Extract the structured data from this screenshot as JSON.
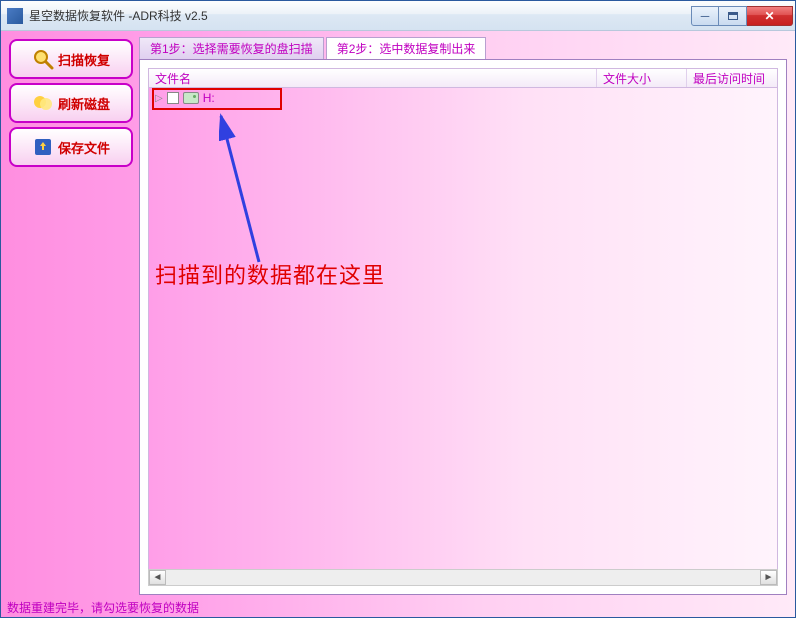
{
  "title": "星空数据恢复软件   -ADR科技 v2.5",
  "sidebar": {
    "items": [
      {
        "label": "扫描恢复"
      },
      {
        "label": "刷新磁盘"
      },
      {
        "label": "保存文件"
      }
    ]
  },
  "tabs": [
    {
      "label": "第1步：选择需要恢复的盘扫描"
    },
    {
      "label": "第2步：选中数据复制出来"
    }
  ],
  "columns": {
    "name": "文件名",
    "size": "文件大小",
    "time": "最后访问时间"
  },
  "rows": [
    {
      "label": "H:"
    }
  ],
  "annotation": "扫描到的数据都在这里",
  "status": "数据重建完毕，请勾选要恢复的数据"
}
